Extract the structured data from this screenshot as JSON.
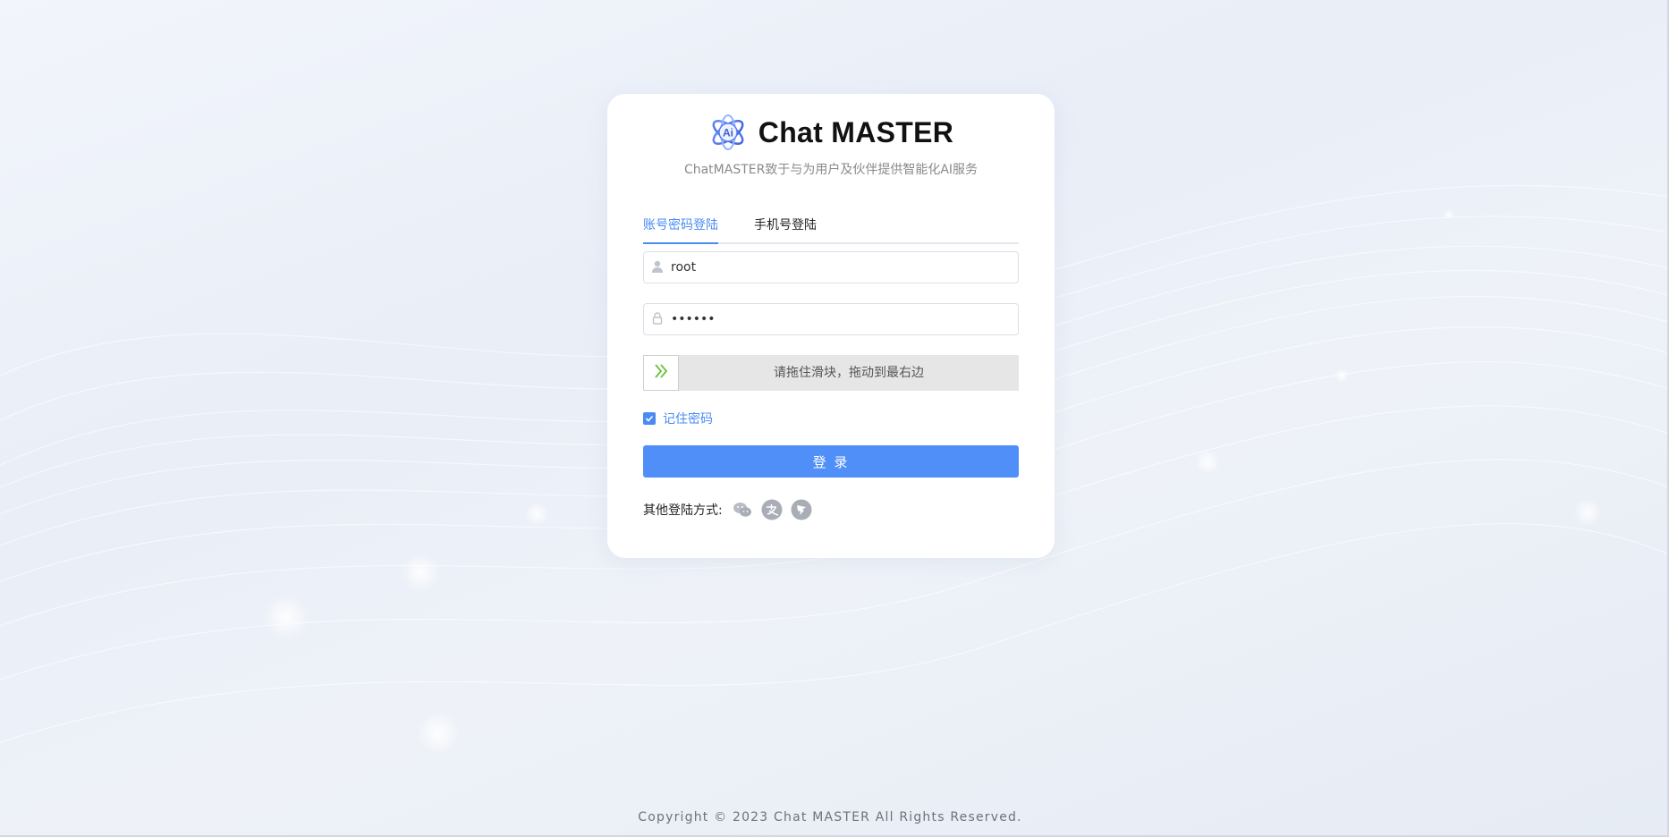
{
  "brand": {
    "name": "Chat MASTER",
    "logo_icon": "ai-orbit-logo-icon"
  },
  "subtitle": "ChatMASTER致于与为用户及伙伴提供智能化AI服务",
  "tabs": [
    {
      "label": "账号密码登陆",
      "active": true
    },
    {
      "label": "手机号登陆",
      "active": false
    }
  ],
  "form": {
    "username": {
      "value": "root",
      "icon": "user-icon"
    },
    "password": {
      "value": "••••••",
      "icon": "lock-icon"
    },
    "slider": {
      "text": "请拖住滑块，拖动到最右边",
      "icon": "double-chevron-right-icon",
      "progress": 0
    },
    "remember": {
      "label": "记住密码",
      "checked": true
    },
    "submit_label": "登 录"
  },
  "other_login": {
    "label": "其他登陆方式:",
    "providers": [
      {
        "name": "wechat",
        "icon": "wechat-icon"
      },
      {
        "name": "alipay",
        "icon": "alipay-icon"
      },
      {
        "name": "dingtalk",
        "icon": "dingtalk-icon"
      }
    ]
  },
  "footer": "Copyright © 2023 Chat MASTER All Rights Reserved.",
  "colors": {
    "accent": "#4a8bf2",
    "button": "#4f8ff7",
    "slider_icon": "#67c23a"
  }
}
